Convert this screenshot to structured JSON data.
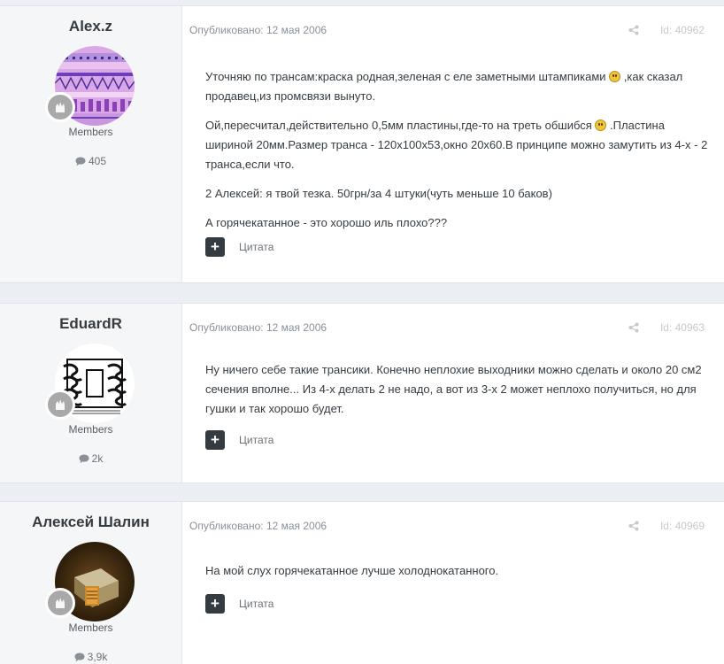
{
  "posts": [
    {
      "author": "Alex.z",
      "group": "Members",
      "post_count": "405",
      "meta": "Опубликовано: 12 мая 2006",
      "id_label": "Id: 40962",
      "paragraphs": [
        "Уточняю по трансам:краска родная,зеленая с еле заметными штампиками",
        ",как сказал продавец,из промсвязи вынуто.",
        "Ой,пересчитал,действительно 0,5мм пластины,где-то на треть обшибся",
        ".Пластина шириной 20мм.Размер транса - 120х100х53,окно 20х60.В принципе можно замутить из 4-х - 2 транса,если что.",
        "2 Алексей: я твой тезка. 50грн/за 4 штуки(чуть меньше 10 баков)",
        "А горячекатанное - это хорошо иль плохо???"
      ],
      "action_plus": "+",
      "action_quote": "Цитата"
    },
    {
      "author": "EduardR",
      "group": "Members",
      "post_count": "2k",
      "meta": "Опубликовано: 12 мая 2006",
      "id_label": "Id: 40963",
      "paragraphs": [
        "Ну ничего себе такие трансики. Конечно неплохие выходники можно сделать и около 20 см2 сечения вполне... Из 4-х делать 2 не надо, а вот из 3-х 2 может неплохо получиться, но для гушки и так хорошо будет."
      ],
      "action_plus": "+",
      "action_quote": "Цитата"
    },
    {
      "author": "Алексей Шалин",
      "group": "Members",
      "post_count": "3,9k",
      "meta": "Опубликовано: 12 мая 2006",
      "id_label": "Id: 40969",
      "paragraphs": [
        "На мой слух горячекатанное лучше холоднокатанного."
      ],
      "action_plus": "+",
      "action_quote": "Цитата"
    }
  ],
  "icons": {
    "share": "share-icon",
    "comment": "comment-icon",
    "rank": "rank-badge-icon",
    "smiley": "smiley-icon"
  },
  "colors": {
    "page_bg": "#ebeef2",
    "author_bg": "#f5f6f7",
    "button_dark": "#353c41",
    "rank_badge": "#a9a9a9"
  }
}
